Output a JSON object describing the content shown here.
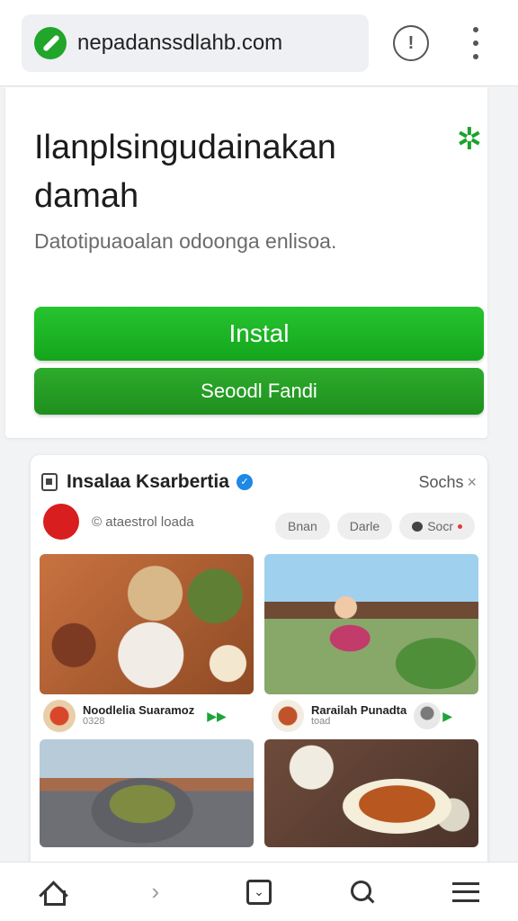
{
  "browser": {
    "url": "nepadanssdlahb.com",
    "site_icon": "site-favicon-icon",
    "info_icon": "info-icon",
    "menu_icon": "more-vert-icon"
  },
  "install_card": {
    "title": "Ilanplsingudainakan damah",
    "badge_icon": "settings-badge-icon",
    "description": "Datotipuaoalan odoonga enlisoa.",
    "primary_button": "Instal",
    "secondary_button": "Seoodl Fandi",
    "accent_color": "#1aa32a"
  },
  "content_card": {
    "title": "Insalaa Ksarbertia",
    "action": "Sochs",
    "action_icon": "close-x",
    "subtitle": "ataestrol loada",
    "chips": [
      "Bnan",
      "Darle",
      "Socr"
    ],
    "tiles": [
      {
        "caption_title": "Noodlelia Suaramoz",
        "caption_sub": "0328"
      },
      {
        "caption_title": "Rarailah Punadta",
        "caption_sub": "toad"
      }
    ]
  },
  "bottom_nav": {
    "forward_glyph": "›",
    "tabs_glyph": "⌄"
  }
}
